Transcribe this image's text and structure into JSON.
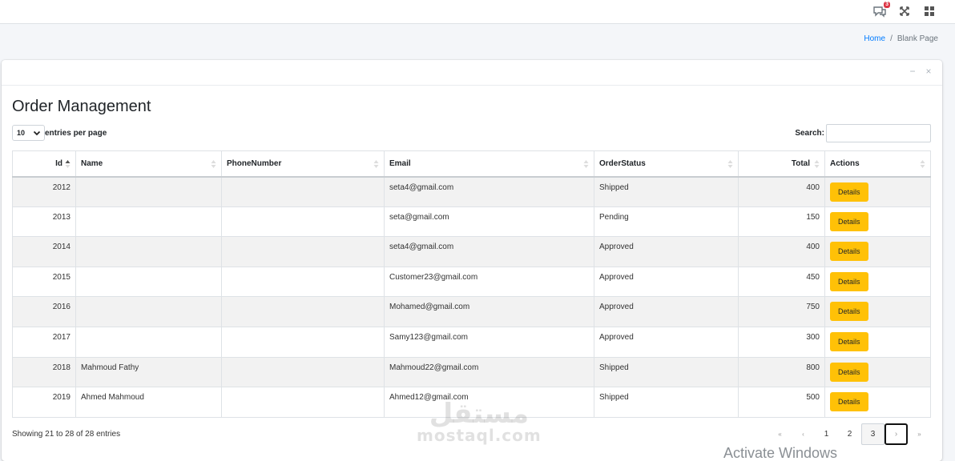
{
  "topbar": {
    "message_badge": "3"
  },
  "breadcrumb": {
    "home": "Home",
    "separator": "/",
    "current": "Blank Page"
  },
  "card": {
    "title": "Order Management",
    "minimize": "−",
    "close": "×"
  },
  "length": {
    "value": "10",
    "label": "entries per page"
  },
  "search": {
    "label": "Search:",
    "value": "",
    "placeholder": ""
  },
  "table": {
    "columns": [
      "Id",
      "Name",
      "PhoneNumber",
      "Email",
      "OrderStatus",
      "Total",
      "Actions"
    ],
    "action_label": "Details",
    "rows": [
      {
        "id": "2012",
        "name": "",
        "phone": "",
        "email": "seta4@gmail.com",
        "status": "Shipped",
        "total": "400"
      },
      {
        "id": "2013",
        "name": "",
        "phone": "",
        "email": "seta@gmail.com",
        "status": "Pending",
        "total": "150"
      },
      {
        "id": "2014",
        "name": "",
        "phone": "",
        "email": "seta4@gmail.com",
        "status": "Approved",
        "total": "400"
      },
      {
        "id": "2015",
        "name": "",
        "phone": "",
        "email": "Customer23@gmail.com",
        "status": "Approved",
        "total": "450"
      },
      {
        "id": "2016",
        "name": "",
        "phone": "",
        "email": "Mohamed@gmail.com",
        "status": "Approved",
        "total": "750"
      },
      {
        "id": "2017",
        "name": "",
        "phone": "",
        "email": "Samy123@gmail.com",
        "status": "Approved",
        "total": "300"
      },
      {
        "id": "2018",
        "name": "Mahmoud Fathy",
        "phone": "",
        "email": "Mahmoud22@gmail.com",
        "status": "Shipped",
        "total": "800"
      },
      {
        "id": "2019",
        "name": "Ahmed Mahmoud",
        "phone": "",
        "email": "Ahmed12@gmail.com",
        "status": "Shipped",
        "total": "500"
      }
    ]
  },
  "info": "Showing 21 to 28 of 28 entries",
  "pagination": {
    "first": "«",
    "prev": "‹",
    "pages": [
      "1",
      "2",
      "3"
    ],
    "next": "›",
    "last": "»",
    "current": "3"
  },
  "watermark": {
    "arabic": "مستقل",
    "latin": "mostaql.com"
  },
  "activate_windows": "Activate Windows",
  "colors": {
    "details_button": "#ffc107",
    "link": "#007bff",
    "badge": "#dc3545"
  },
  "icons": {
    "messages": "comments-icon",
    "fullscreen": "expand-icon",
    "apps": "grid-icon"
  }
}
